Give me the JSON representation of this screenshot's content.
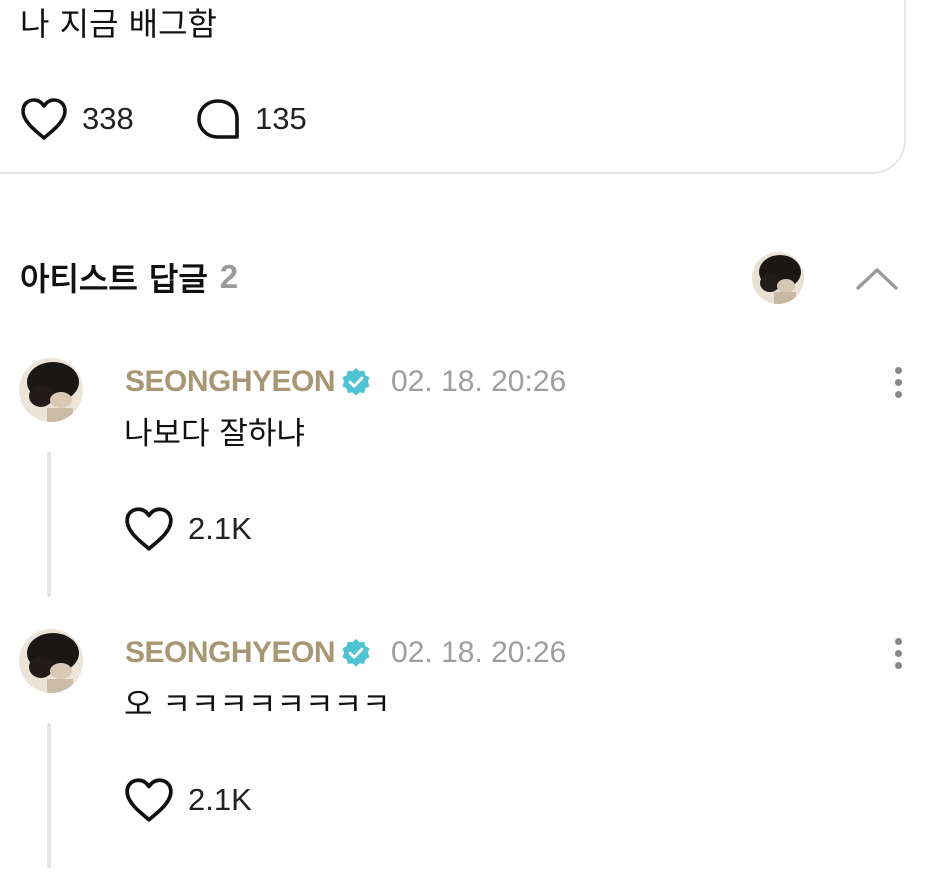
{
  "post": {
    "text": "나 지금 배그함",
    "likes": "338",
    "comments": "135"
  },
  "artist_replies": {
    "title": "아티스트 답글",
    "count": "2"
  },
  "comments": [
    {
      "author": "SEONGHYEON",
      "time": "02. 18. 20:26",
      "text": "나보다 잘하냐",
      "likes": "2.1K"
    },
    {
      "author": "SEONGHYEON",
      "time": "02. 18. 20:26",
      "text": "오 ㅋㅋㅋㅋㅋㅋㅋㅋ",
      "likes": "2.1K"
    }
  ],
  "icons": {
    "like": "heart-outline-icon",
    "comment": "speech-bubble-icon",
    "verified": "verified-badge-icon",
    "collapse": "chevron-up-icon",
    "more": "more-vertical-icon"
  },
  "colors": {
    "author": "#a89773",
    "verified": "#4fc3d4",
    "timestamp": "#9e9e9e",
    "count_muted": "#9a9a9a"
  }
}
